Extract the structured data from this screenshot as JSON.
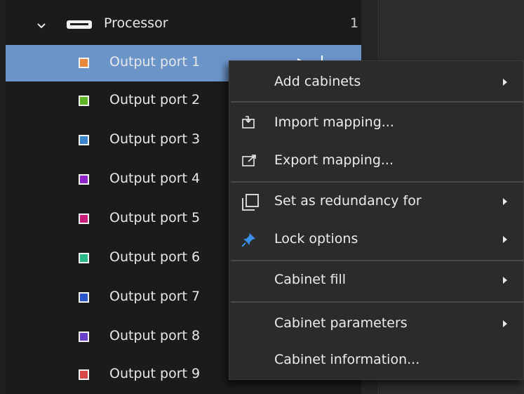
{
  "tree": {
    "processor": {
      "label": "Processor",
      "count": "1"
    },
    "ports": [
      {
        "label": "Output port 1",
        "color": "#e8883a"
      },
      {
        "label": "Output port 2",
        "color": "#5fb426"
      },
      {
        "label": "Output port 3",
        "color": "#3a86c8"
      },
      {
        "label": "Output port 4",
        "color": "#8d25c8"
      },
      {
        "label": "Output port 5",
        "color": "#c81e78"
      },
      {
        "label": "Output port 6",
        "color": "#29b885"
      },
      {
        "label": "Output port 7",
        "color": "#2a55c8"
      },
      {
        "label": "Output port 8",
        "color": "#6a3ec8"
      },
      {
        "label": "Output port 9",
        "color": "#d84848"
      }
    ]
  },
  "context_menu": {
    "add_cabinets": "Add cabinets",
    "import_mapping": "Import mapping...",
    "export_mapping": "Export mapping...",
    "set_redundancy": "Set as redundancy for",
    "lock_options": "Lock options",
    "cabinet_fill": "Cabinet fill",
    "cabinet_parameters": "Cabinet parameters",
    "cabinet_information": "Cabinet information..."
  },
  "colors": {
    "selection": "#6b95c9",
    "menu_bg": "#2b2b2b",
    "pin_icon": "#3a8ee6"
  }
}
